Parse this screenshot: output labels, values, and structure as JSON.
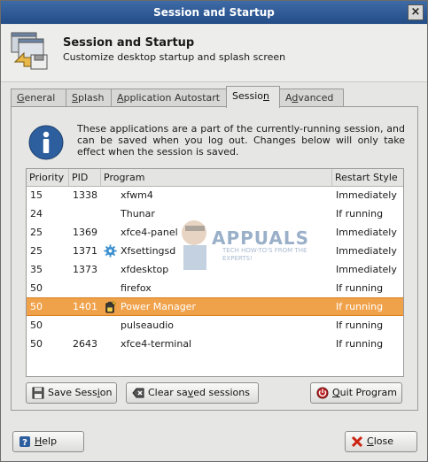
{
  "window": {
    "title": "Session and Startup",
    "close_glyph": "×"
  },
  "header": {
    "title": "Session and Startup",
    "subtitle": "Customize desktop startup and splash screen",
    "icon": "session-startup-icon"
  },
  "tabs": [
    {
      "label": "General",
      "underline": "G",
      "rest": "eneral"
    },
    {
      "label": "Splash",
      "underline": "S",
      "rest": "plash"
    },
    {
      "label": "Application Autostart",
      "underline": "A",
      "rest": "pplication Autostart"
    },
    {
      "label": "Session",
      "active": true,
      "pre": "Sessio",
      "underline": "n",
      "rest": ""
    },
    {
      "label": "Advanced",
      "pre": "A",
      "underline": "d",
      "rest": "vanced"
    }
  ],
  "info": {
    "icon": "info-icon",
    "text": "These applications are a part of the currently-running session, and can be saved when you log out. Changes below will only take effect when the session is saved."
  },
  "table": {
    "columns": [
      "Priority",
      "PID",
      "Program",
      "Restart Style"
    ],
    "rows": [
      {
        "priority": "15",
        "pid": "1338",
        "program": "xfwm4",
        "restart": "Immediately"
      },
      {
        "priority": "24",
        "pid": "",
        "program": "Thunar",
        "restart": "If running"
      },
      {
        "priority": "25",
        "pid": "1369",
        "program": "xfce4-panel",
        "restart": "Immediately"
      },
      {
        "priority": "25",
        "pid": "1371",
        "program": "Xfsettingsd",
        "restart": "Immediately",
        "icon": "gear-icon"
      },
      {
        "priority": "35",
        "pid": "1373",
        "program": "xfdesktop",
        "restart": "Immediately"
      },
      {
        "priority": "50",
        "pid": "",
        "program": "firefox",
        "restart": "If running"
      },
      {
        "priority": "50",
        "pid": "1401",
        "program": "Power Manager",
        "restart": "If running",
        "icon": "battery-icon",
        "selected": true
      },
      {
        "priority": "50",
        "pid": "",
        "program": "pulseaudio",
        "restart": "If running"
      },
      {
        "priority": "50",
        "pid": "2643",
        "program": "xfce4-terminal",
        "restart": "If running"
      }
    ]
  },
  "buttons": {
    "save_session": {
      "pre": "Save Sess",
      "underline": "i",
      "rest": "on",
      "icon": "save-icon"
    },
    "clear_sessions": {
      "pre": "Clear sa",
      "underline": "v",
      "rest": "ed sessions",
      "icon": "clear-icon"
    },
    "quit_program": {
      "pre": "",
      "underline": "Q",
      "rest": "uit Program",
      "icon": "quit-icon"
    },
    "help": {
      "pre": "",
      "underline": "H",
      "rest": "elp",
      "icon": "help-icon"
    },
    "close": {
      "pre": "",
      "underline": "C",
      "rest": "lose",
      "icon": "close-icon"
    }
  },
  "watermark": {
    "title": "APPUALS",
    "subtitle": "TECH HOW-TO'S FROM THE EXPERTS!"
  },
  "colors": {
    "titlebar": "#2f5b98",
    "selection": "#f0a24b",
    "info_blue": "#2d5f9e"
  }
}
